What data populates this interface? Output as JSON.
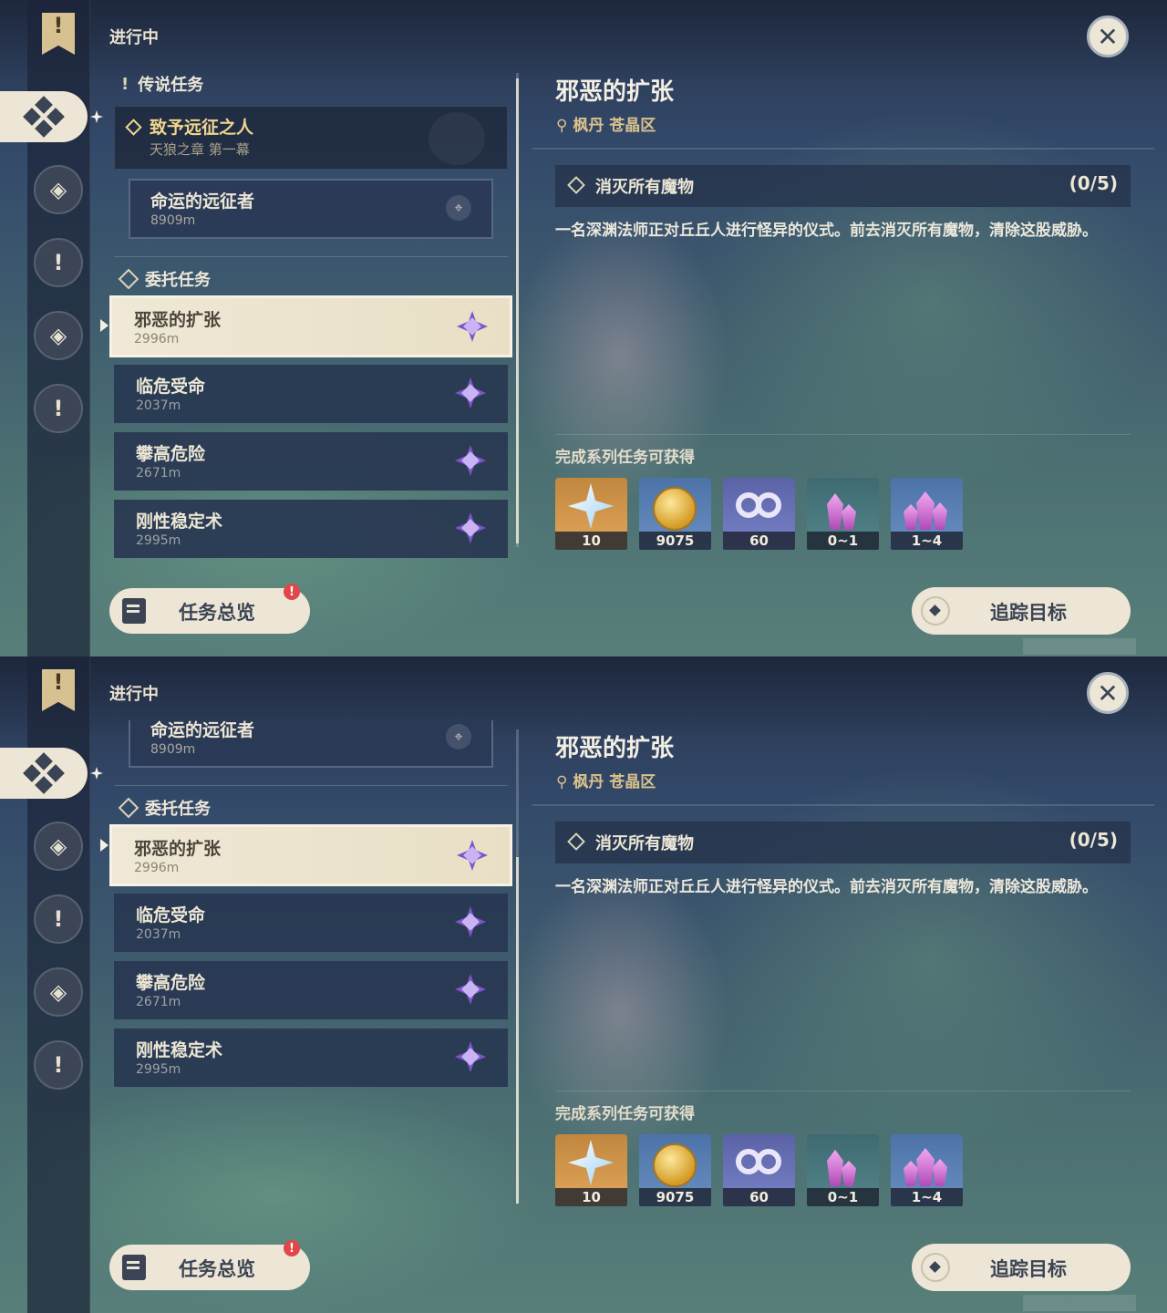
{
  "screens": [
    {
      "status_label": "进行中",
      "sections": {
        "legend_header": "传说任务",
        "commission_header": "委托任务"
      },
      "legend_quest": {
        "title": "致予远征之人",
        "chapter": "天狼之章 第一幕"
      },
      "legend_subquest": {
        "title": "命运的远征者",
        "distance": "8909m"
      },
      "tasks": [
        {
          "title": "邪恶的扩张",
          "distance": "2996m",
          "selected": true
        },
        {
          "title": "临危受命",
          "distance": "2037m"
        },
        {
          "title": "攀高危险",
          "distance": "2671m"
        },
        {
          "title": "刚性稳定术",
          "distance": "2995m"
        }
      ],
      "detail": {
        "title": "邪恶的扩张",
        "location": "枫丹 苍晶区",
        "objective": "消灭所有魔物",
        "objective_count": "(0/5)",
        "description": "一名深渊法师正对丘丘人进行怪异的仪式。前去消灭所有魔物，清除这股威胁。",
        "rewards_title": "完成系列任务可获得",
        "rewards": [
          {
            "icon": "primogem-icon",
            "amount": "10"
          },
          {
            "icon": "mora-icon",
            "amount": "9075"
          },
          {
            "icon": "friendship-exp-icon",
            "amount": "60"
          },
          {
            "icon": "crystal-chunk-icon",
            "amount": "0~1"
          },
          {
            "icon": "crystal-cluster-icon",
            "amount": "1~4"
          }
        ]
      },
      "buttons": {
        "overview": "任务总览",
        "overview_badge": "!",
        "track": "追踪目标"
      }
    },
    {
      "status_label": "进行中",
      "sections": {
        "commission_header": "委托任务"
      },
      "legend_subquest": {
        "title": "命运的远征者",
        "distance": "8909m"
      },
      "tasks": [
        {
          "title": "邪恶的扩张",
          "distance": "2996m",
          "selected": true
        },
        {
          "title": "临危受命",
          "distance": "2037m"
        },
        {
          "title": "攀高危险",
          "distance": "2671m"
        },
        {
          "title": "刚性稳定术",
          "distance": "2995m"
        }
      ],
      "detail": {
        "title": "邪恶的扩张",
        "location": "枫丹 苍晶区",
        "objective": "消灭所有魔物",
        "objective_count": "(0/5)",
        "description": "一名深渊法师正对丘丘人进行怪异的仪式。前去消灭所有魔物，清除这股威胁。",
        "rewards_title": "完成系列任务可获得",
        "rewards": [
          {
            "icon": "primogem-icon",
            "amount": "10"
          },
          {
            "icon": "mora-icon",
            "amount": "9075"
          },
          {
            "icon": "friendship-exp-icon",
            "amount": "60"
          },
          {
            "icon": "crystal-chunk-icon",
            "amount": "0~1"
          },
          {
            "icon": "crystal-cluster-icon",
            "amount": "1~4"
          }
        ]
      },
      "buttons": {
        "overview": "任务总览",
        "overview_badge": "!",
        "track": "追踪目标"
      }
    }
  ],
  "rail_icons": [
    "bookmark-icon",
    "commission-icon",
    "compass-icon",
    "exclamation-icon",
    "diamond-icon",
    "exclamation-icon"
  ],
  "colors": {
    "accent_gold": "#f0d58f",
    "panel_dark": "#283751",
    "cream": "#ede6d6",
    "commission_purple": "#7c55c8"
  }
}
